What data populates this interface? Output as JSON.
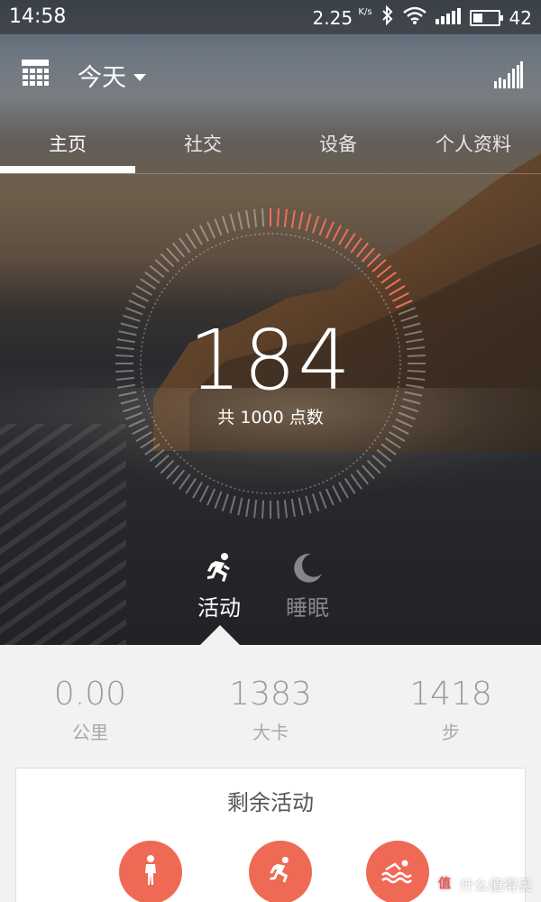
{
  "status_bar": {
    "time": "14:58",
    "speed": "2.25",
    "speed_unit": "K/s",
    "battery": "42",
    "battery_level_percent": 42,
    "icons": [
      "bluetooth-icon",
      "wifi-icon",
      "cellular-signal-icon",
      "battery-icon"
    ]
  },
  "header": {
    "date_selector": "今天",
    "icons": [
      "calendar-icon",
      "stats-chart-icon",
      "chevron-down-icon"
    ]
  },
  "tabs": [
    {
      "label": "主页",
      "active": true
    },
    {
      "label": "社交",
      "active": false
    },
    {
      "label": "设备",
      "active": false
    },
    {
      "label": "个人资料",
      "active": false
    }
  ],
  "progress": {
    "score": "184",
    "subtitle": "共 1000 点数",
    "value": 184,
    "goal": 1000,
    "accent_color": "#ee6f5c"
  },
  "modes": [
    {
      "label": "活动",
      "icon": "running-icon",
      "active": true
    },
    {
      "label": "睡眠",
      "icon": "moon-icon",
      "active": false
    }
  ],
  "stats": [
    {
      "value": "0.00",
      "unit": "公里"
    },
    {
      "value": "1383",
      "unit": "大卡"
    },
    {
      "value": "1418",
      "unit": "步"
    }
  ],
  "remaining_card": {
    "title": "剩余活动",
    "activities": [
      {
        "icon": "walking-icon"
      },
      {
        "icon": "running-icon"
      },
      {
        "icon": "swimming-icon"
      }
    ],
    "color": "#ef6a55"
  },
  "watermark": {
    "badge": "值",
    "text": "什么值得买"
  }
}
